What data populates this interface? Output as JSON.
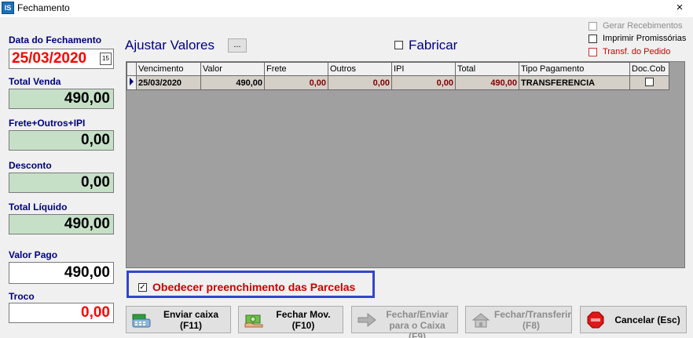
{
  "window": {
    "title": "Fechamento",
    "icon_text": "IS",
    "close": "×"
  },
  "left": {
    "data_label": "Data do Fechamento",
    "data_value": "25/03/2020",
    "calendar_icon_text": "15",
    "total_venda_label": "Total Venda",
    "total_venda_value": "490,00",
    "frete_label": "Frete+Outros+IPI",
    "frete_value": "0,00",
    "desconto_label": "Desconto",
    "desconto_value": "0,00",
    "total_liquido_label": "Total Líquido",
    "total_liquido_value": "490,00",
    "valor_pago_label": "Valor Pago",
    "valor_pago_value": "490,00",
    "troco_label": "Troco",
    "troco_value": "0,00"
  },
  "header": {
    "ajustar_label": "Ajustar Valores",
    "ajustar_button": "...",
    "fabricar_label": "Fabricar"
  },
  "options": [
    {
      "label": "Gerar Recebimentos",
      "state": "disabled"
    },
    {
      "label": "Imprimir Promissórias",
      "state": "normal"
    },
    {
      "label": "Transf. do Pedido",
      "state": "red"
    }
  ],
  "grid": {
    "columns": [
      "Vencimento",
      "Valor",
      "Frete",
      "Outros",
      "IPI",
      "Total",
      "Tipo Pagamento",
      "Doc.Cob"
    ],
    "rows": [
      {
        "vencimento": "25/03/2020",
        "valor": "490,00",
        "frete": "0,00",
        "outros": "0,00",
        "ipi": "0,00",
        "total": "490,00",
        "tipo": "TRANSFERENCIA"
      }
    ]
  },
  "obedecer": {
    "label": "Obedecer preenchimento das Parcelas",
    "check": "✓"
  },
  "buttons": {
    "enviar_caixa_1": "Enviar caixa",
    "enviar_caixa_2": "(F11)",
    "fechar_mov_1": "Fechar Mov.",
    "fechar_mov_2": "(F10)",
    "fechar_enviar_1": "Fechar/Enviar",
    "fechar_enviar_2": "para o Caixa (F9)",
    "fechar_transferir_1": "Fechar/Transferir",
    "fechar_transferir_2": "(F8)",
    "cancelar": "Cancelar (Esc)"
  },
  "icons": {
    "app": "app-icon",
    "calendar": "calendar-icon",
    "cash_register": "cash-register-icon",
    "money_hand": "money-hand-icon",
    "arrow_right": "arrow-right-icon",
    "house": "house-icon",
    "stop": "stop-icon"
  },
  "colors": {
    "accent_blue": "#000080",
    "highlight_border": "#3347c7",
    "green_field": "#c6e0c8",
    "red_text": "#ff0000"
  }
}
